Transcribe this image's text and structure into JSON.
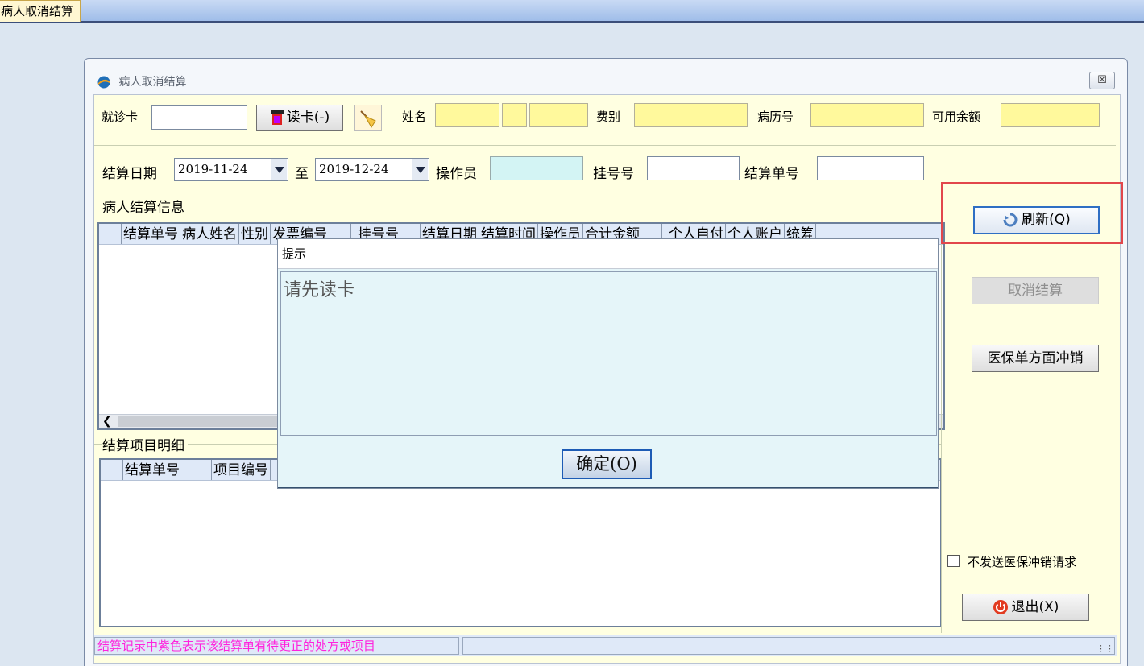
{
  "top_tab": {
    "label": "病人取消结算"
  },
  "window": {
    "title": "病人取消结算",
    "close_label": "☒",
    "row1": {
      "card_label": "就诊卡",
      "card_value": "",
      "read_card_label": "读卡(-)",
      "name_label": "姓名",
      "fee_type_label": "费别",
      "record_no_label": "病历号",
      "balance_label": "可用余额"
    },
    "row2": {
      "settle_date_label": "结算日期",
      "date_from": "2019-11-24",
      "to_label": "至",
      "date_to": "2019-12-24",
      "operator_label": "操作员",
      "reg_no_label": "挂号号",
      "settle_no_label": "结算单号"
    },
    "patient_group": {
      "label": "病人结算信息",
      "columns": [
        "结算单号",
        "病人姓名",
        "性别",
        "发票编号",
        "挂号号",
        "结算日期",
        "结算时间",
        "操作员",
        "合计金额",
        "个人自付",
        "个人账户",
        "统筹"
      ]
    },
    "detail_group": {
      "label": "结算项目明细",
      "columns": [
        "结算单号",
        "项目编号"
      ]
    },
    "sidebar": {
      "refresh_label": "刷新(Q)",
      "cancel_settle_label": "取消结算",
      "insurance_reversal_label": "医保单方面冲销",
      "no_send_label": "不发送医保冲销请求",
      "exit_label": "退出(X)"
    },
    "status": {
      "message": "结算记录中紫色表示该结算单有待更正的处方或项目",
      "message_color": "#ff22dd"
    }
  },
  "dialog": {
    "title": "提示",
    "message": "请先读卡",
    "ok_label": "确定(O)"
  }
}
